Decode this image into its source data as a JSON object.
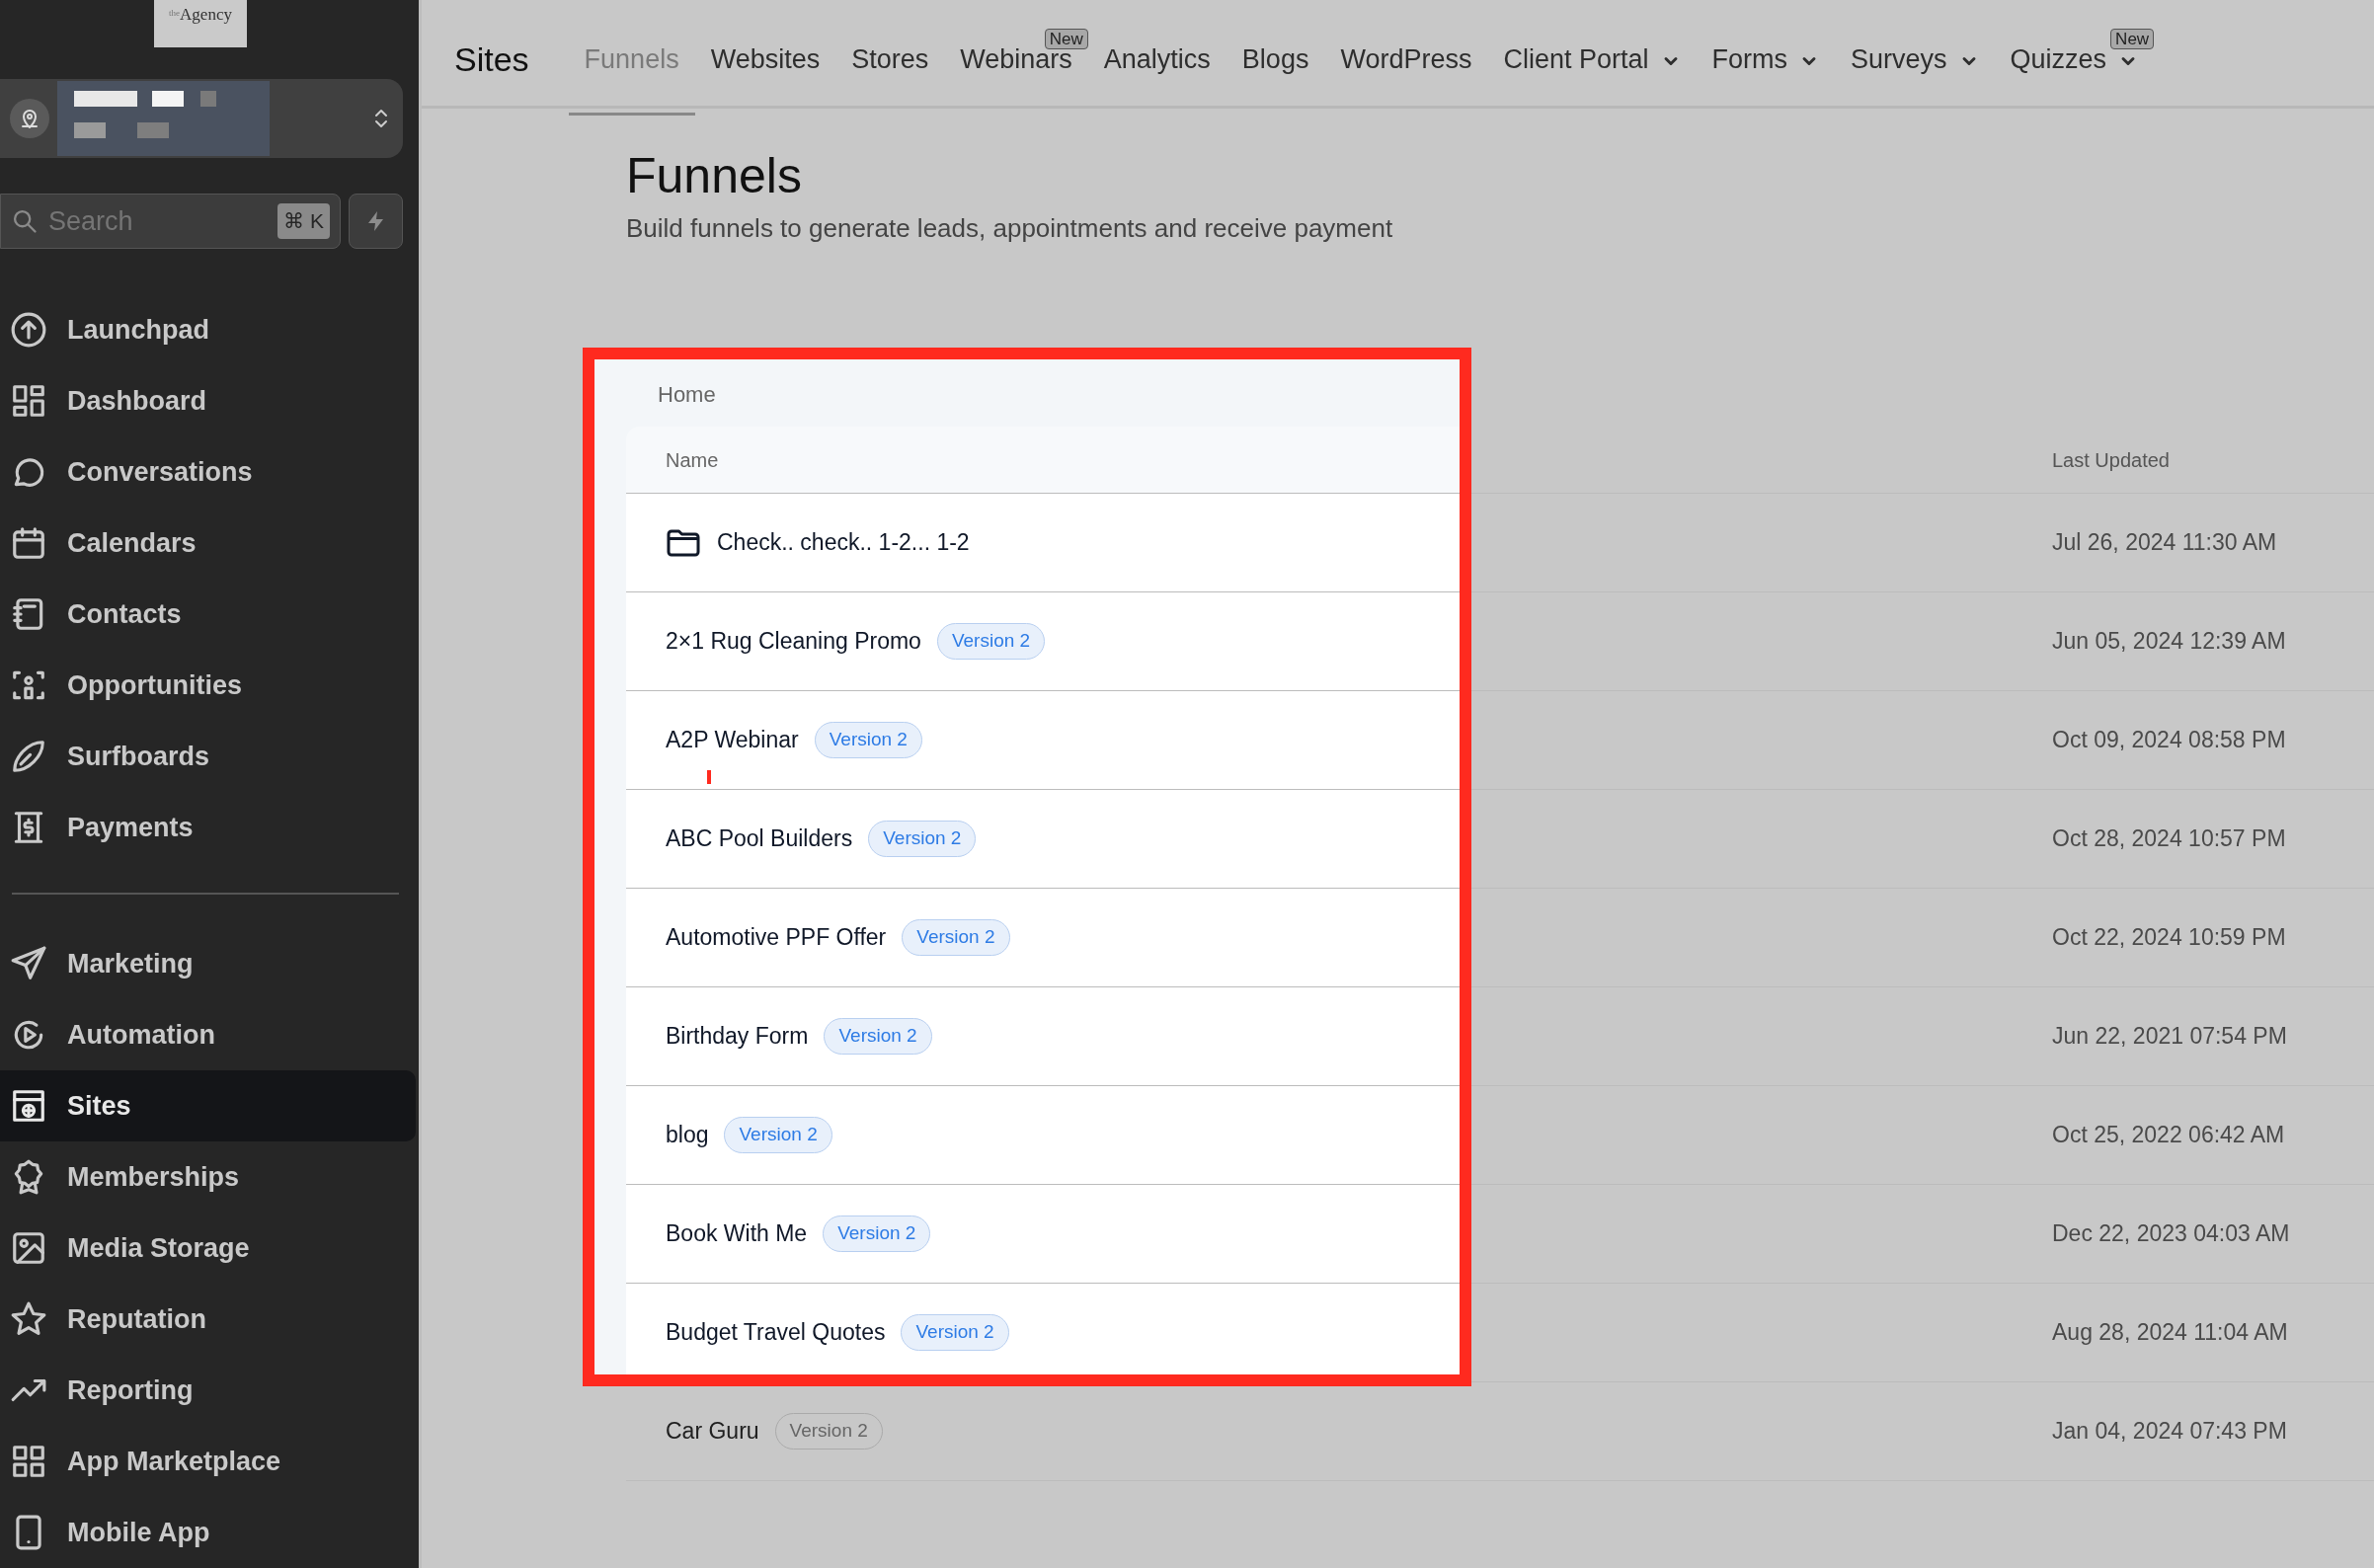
{
  "logo": {
    "text": "$^{the}$Agency"
  },
  "search": {
    "placeholder": "Search",
    "shortcut": "⌘ K"
  },
  "sidebar": {
    "groups": [
      {
        "items": [
          {
            "label": "Launchpad",
            "selected": false
          },
          {
            "label": "Dashboard",
            "selected": false
          },
          {
            "label": "Conversations",
            "selected": false
          },
          {
            "label": "Calendars",
            "selected": false
          },
          {
            "label": "Contacts",
            "selected": false
          },
          {
            "label": "Opportunities",
            "selected": false
          },
          {
            "label": "Surfboards",
            "selected": false
          },
          {
            "label": "Payments",
            "selected": false
          }
        ]
      },
      {
        "items": [
          {
            "label": "Marketing",
            "selected": false
          },
          {
            "label": "Automation",
            "selected": false
          },
          {
            "label": "Sites",
            "selected": true
          },
          {
            "label": "Memberships",
            "selected": false
          },
          {
            "label": "Media Storage",
            "selected": false
          },
          {
            "label": "Reputation",
            "selected": false
          },
          {
            "label": "Reporting",
            "selected": false
          },
          {
            "label": "App Marketplace",
            "selected": false
          },
          {
            "label": "Mobile App",
            "selected": false
          }
        ]
      }
    ]
  },
  "topnav": {
    "title": "Sites",
    "tabs": [
      {
        "label": "Funnels",
        "selected": true,
        "dropdown": false
      },
      {
        "label": "Websites",
        "selected": false,
        "dropdown": false
      },
      {
        "label": "Stores",
        "selected": false,
        "dropdown": false
      },
      {
        "label": "Webinars",
        "selected": false,
        "dropdown": false,
        "badge": "New"
      },
      {
        "label": "Analytics",
        "selected": false,
        "dropdown": false
      },
      {
        "label": "Blogs",
        "selected": false,
        "dropdown": false
      },
      {
        "label": "WordPress",
        "selected": false,
        "dropdown": false
      },
      {
        "label": "Client Portal",
        "selected": false,
        "dropdown": true
      },
      {
        "label": "Forms",
        "selected": false,
        "dropdown": true
      },
      {
        "label": "Surveys",
        "selected": false,
        "dropdown": true
      },
      {
        "label": "Quizzes",
        "selected": false,
        "dropdown": true,
        "badge": "New"
      }
    ]
  },
  "page": {
    "title": "Funnels",
    "subtitle": "Build funnels to generate leads, appointments and receive payment"
  },
  "breadcrumb": "Home",
  "annotation": {
    "kind": "frame"
  },
  "table": {
    "columns": [
      "Name",
      "Last Updated"
    ],
    "rows": [
      {
        "kind": "folder",
        "name": "Check.. check.. 1-2... 1-2",
        "updated": "Jul 26, 2024 11:30 AM",
        "highlighted": true
      },
      {
        "kind": "funnel",
        "name": "2×1 Rug Cleaning Promo",
        "badge": "Version 2",
        "updated": "Jun 05, 2024 12:39 AM",
        "highlighted": true
      },
      {
        "kind": "funnel",
        "name": "A2P Webinar",
        "badge": "Version 2",
        "updated": "Oct 09, 2024 08:58 PM",
        "highlighted": true
      },
      {
        "kind": "funnel",
        "name": "ABC Pool Builders",
        "badge": "Version 2",
        "updated": "Oct 28, 2024 10:57 PM",
        "highlighted": true
      },
      {
        "kind": "funnel",
        "name": "Automotive PPF Offer",
        "badge": "Version 2",
        "updated": "Oct 22, 2024 10:59 PM",
        "highlighted": true
      },
      {
        "kind": "funnel",
        "name": "Birthday Form",
        "badge": "Version 2",
        "updated": "Jun 22, 2021 07:54 PM",
        "highlighted": true
      },
      {
        "kind": "funnel",
        "name": "blog",
        "badge": "Version 2",
        "updated": "Oct 25, 2022 06:42 AM",
        "highlighted": true
      },
      {
        "kind": "funnel",
        "name": "Book With Me",
        "badge": "Version 2",
        "updated": "Dec 22, 2023 04:03 AM",
        "highlighted": true
      },
      {
        "kind": "funnel",
        "name": "Budget Travel Quotes",
        "badge": "Version 2",
        "updated": "Aug 28, 2024 11:04 AM",
        "highlighted": true
      },
      {
        "kind": "funnel",
        "name": "Car Guru",
        "badge": "Version 2",
        "updated": "Jan 04, 2024 07:43 PM",
        "highlighted": false
      }
    ]
  }
}
